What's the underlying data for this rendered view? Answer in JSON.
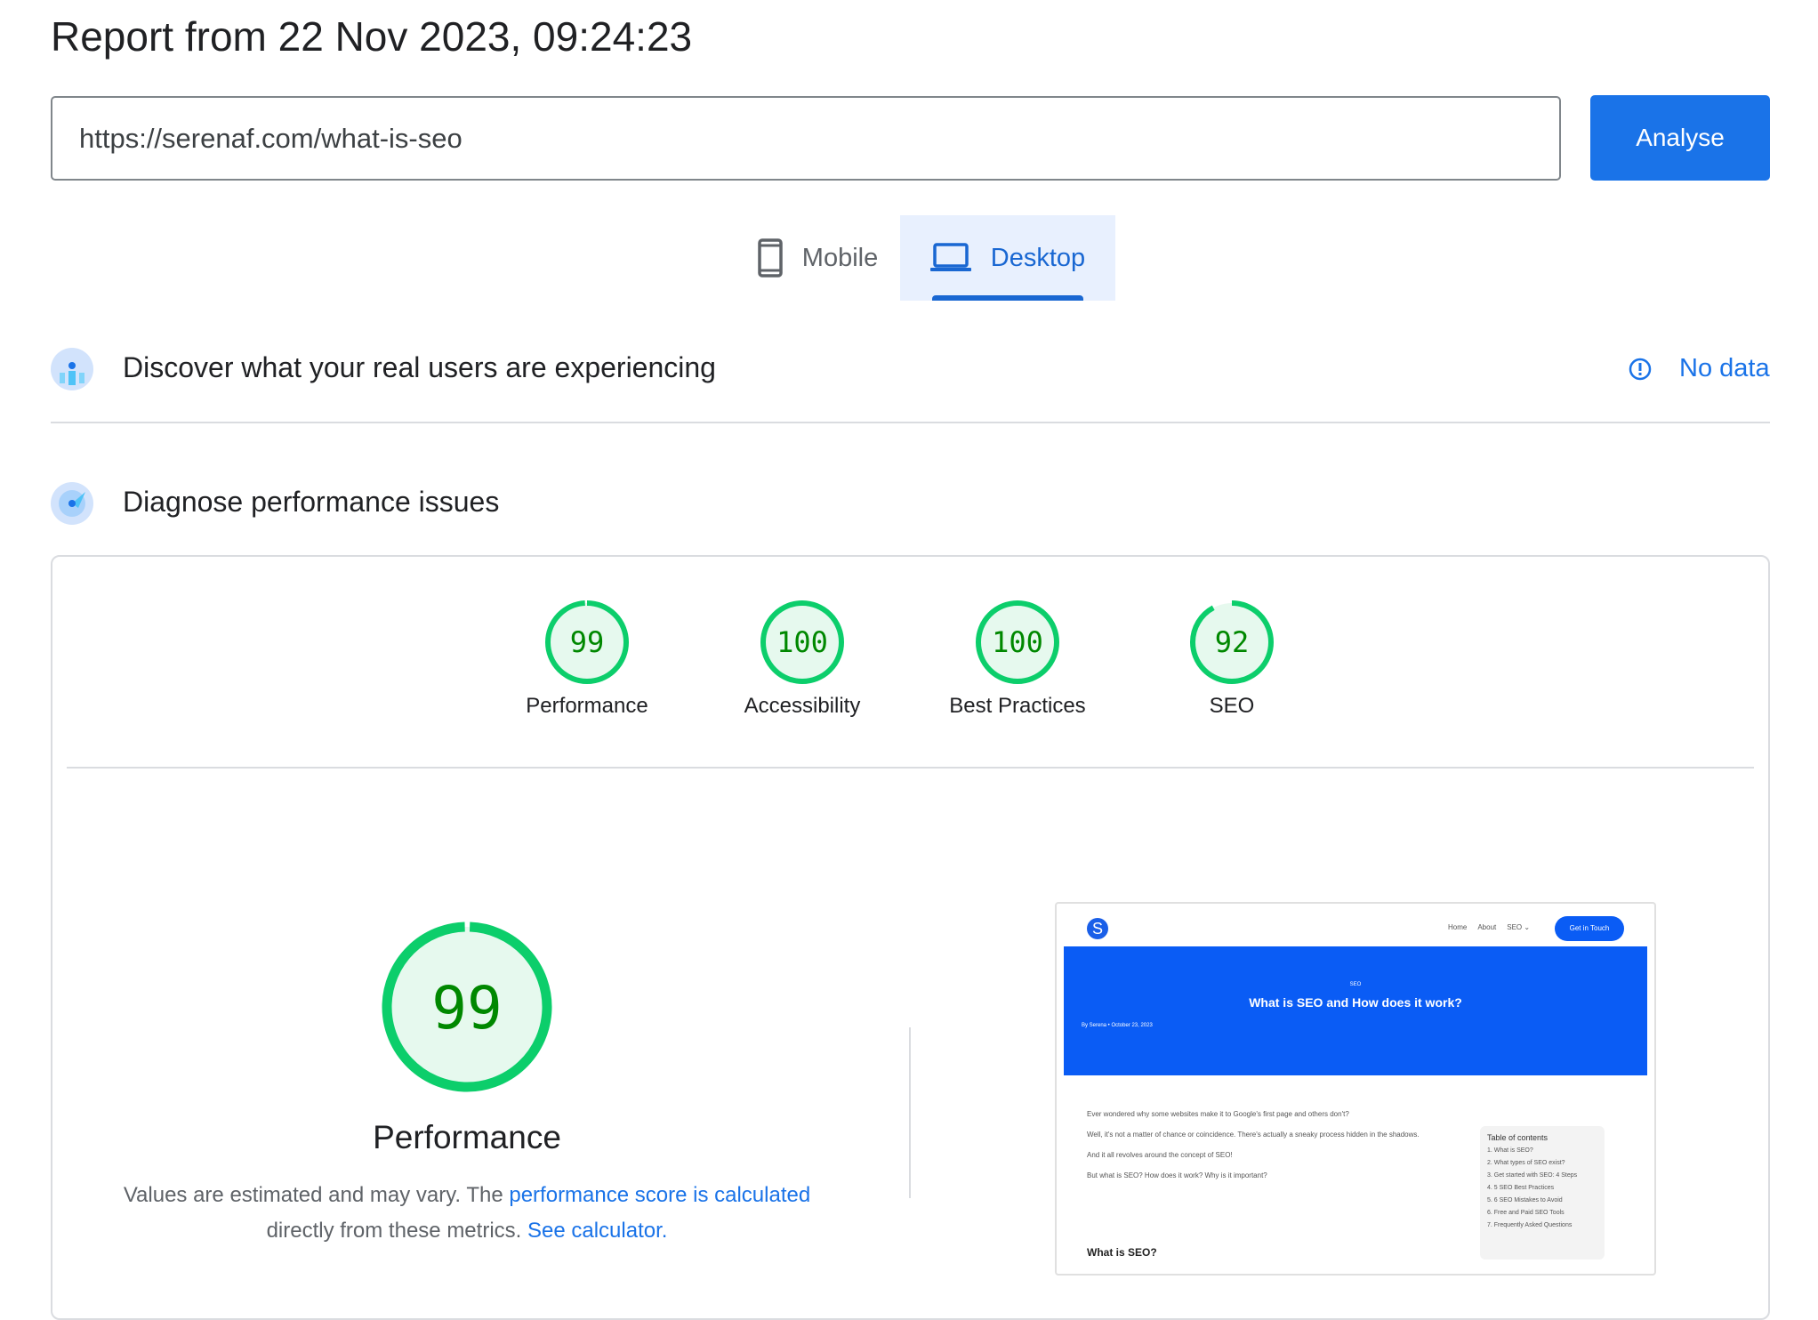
{
  "header": {
    "title": "Report from 22 Nov 2023, 09:24:23"
  },
  "search": {
    "url": "https://serenaf.com/what-is-seo",
    "analyse_label": "Analyse"
  },
  "tabs": [
    {
      "label": "Mobile",
      "icon": "phone-icon",
      "active": false
    },
    {
      "label": "Desktop",
      "icon": "laptop-icon",
      "active": true
    }
  ],
  "field_data": {
    "title": "Discover what your real users are experiencing",
    "status": "No data"
  },
  "lab_data": {
    "title": "Diagnose performance issues"
  },
  "scores": [
    {
      "label": "Performance",
      "value": "99"
    },
    {
      "label": "Accessibility",
      "value": "100"
    },
    {
      "label": "Best Practices",
      "value": "100"
    },
    {
      "label": "SEO",
      "value": "92"
    }
  ],
  "colors": {
    "pass": "#0cce6b",
    "pass_text": "#008800",
    "accent": "#1a73e8"
  },
  "performance": {
    "score": "99",
    "label": "Performance",
    "desc_1": "Values are estimated and may vary. The ",
    "link_1": "performance score is calculated",
    "desc_2": "directly from these metrics. ",
    "link_2": "See calculator."
  },
  "screenshot": {
    "logo": "S",
    "nav": [
      "Home",
      "About",
      "SEO ⌄"
    ],
    "cta": "Get in Touch",
    "category": "SEO",
    "headline": "What is SEO and How does it work?",
    "byline": "By Serena • October 23, 2023",
    "paragraphs": [
      "Ever wondered why some websites make it to Google's first page and others don't?",
      "Well, it's not a matter of chance or coincidence. There's actually a sneaky process hidden in the shadows.",
      "And it all revolves around the concept of SEO!",
      "But what is SEO? How does it work? Why is it important?"
    ],
    "subheading": "What is SEO?",
    "toc_title": "Table of contents",
    "toc": [
      "1. What is SEO?",
      "2. What types of SEO exist?",
      "3. Get started with SEO: 4 Steps",
      "4. 5 SEO Best Practices",
      "5. 6 SEO Mistakes to Avoid",
      "6. Free and Paid SEO Tools",
      "7. Frequently Asked Questions"
    ]
  }
}
